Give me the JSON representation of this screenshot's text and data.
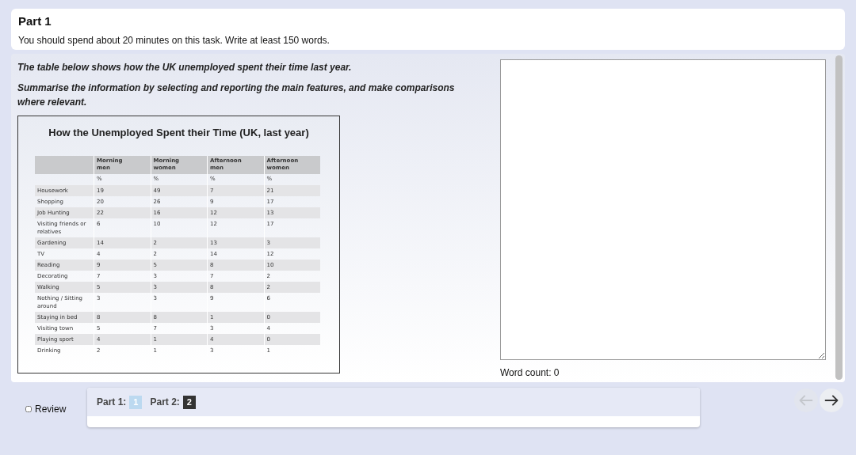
{
  "header": {
    "title": "Part 1",
    "instructions": "You should spend about 20 minutes on this task. Write at least 150 words."
  },
  "prompt": [
    "The table below shows how the UK unemployed spent their time last year.",
    "Summarise the information by selecting and reporting the main features, and make comparisons where relevant."
  ],
  "table": {
    "title": "How the Unemployed Spent their Time (UK, last year)",
    "columns": [
      "",
      "Morning men",
      "Morning women",
      "Afternoon men",
      "Afternoon women"
    ],
    "units": [
      "%",
      "%",
      "%",
      "%"
    ],
    "rows": [
      [
        "Housework",
        "19",
        "49",
        "7",
        "21"
      ],
      [
        "Shopping",
        "20",
        "26",
        "9",
        "17"
      ],
      [
        "Job Hunting",
        "22",
        "16",
        "12",
        "13"
      ],
      [
        "Visiting friends or relatives",
        "6",
        "10",
        "12",
        "17"
      ],
      [
        "Gardening",
        "14",
        "2",
        "13",
        "3"
      ],
      [
        "TV",
        "4",
        "2",
        "14",
        "12"
      ],
      [
        "Reading",
        "9",
        "5",
        "8",
        "10"
      ],
      [
        "Decorating",
        "7",
        "3",
        "7",
        "2"
      ],
      [
        "Walking",
        "5",
        "3",
        "8",
        "2"
      ],
      [
        "Nothing / Sitting around",
        "3",
        "3",
        "9",
        "6"
      ],
      [
        "Staying in bed",
        "8",
        "8",
        "1",
        "0"
      ],
      [
        "Visiting town",
        "5",
        "7",
        "3",
        "4"
      ],
      [
        "Playing sport",
        "4",
        "1",
        "4",
        "0"
      ],
      [
        "Drinking",
        "2",
        "1",
        "3",
        "1"
      ]
    ]
  },
  "answer": {
    "word_count": "Word count: 0"
  },
  "footer": {
    "review": {
      "label": "Review",
      "checked": false
    },
    "parts": [
      {
        "label": "Part 1:",
        "number": "1",
        "selected": true
      },
      {
        "label": "Part 2:",
        "number": "2",
        "selected": false
      }
    ],
    "nav": [
      {
        "kind": "back",
        "disabled": true
      },
      {
        "kind": "forward",
        "disabled": false
      }
    ]
  }
}
